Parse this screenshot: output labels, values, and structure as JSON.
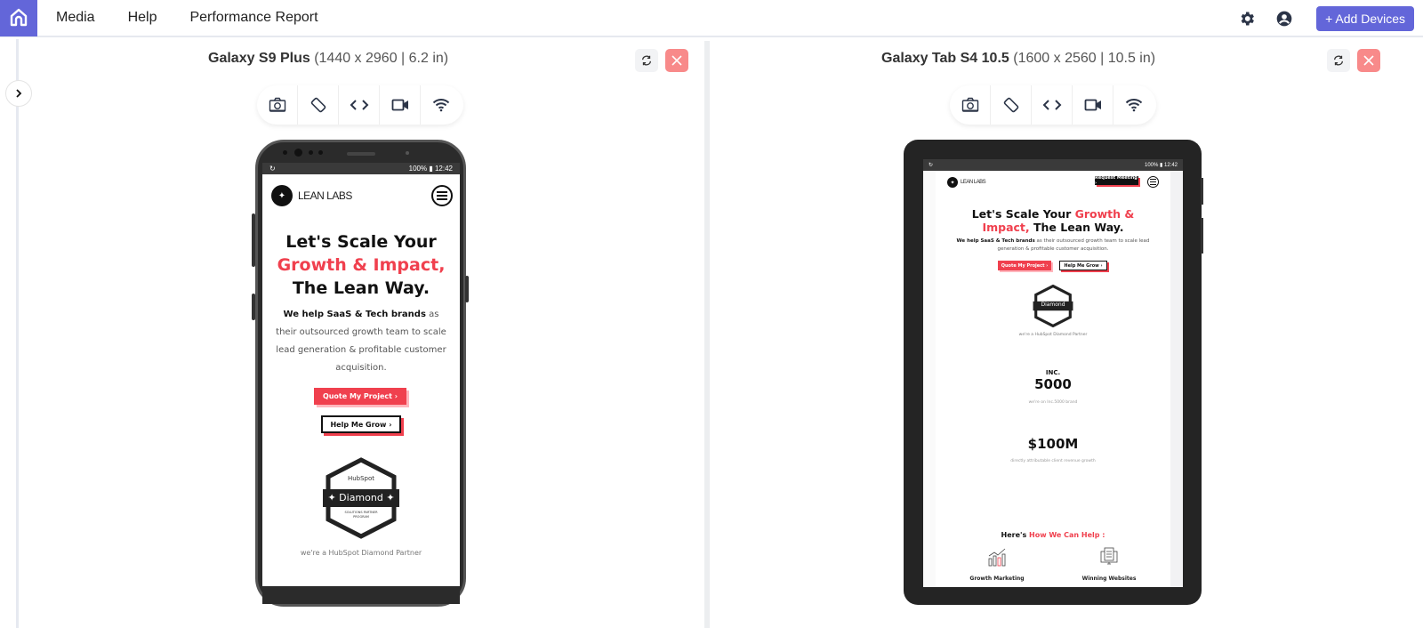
{
  "topbar": {
    "nav": [
      "Media",
      "Help",
      "Performance Report"
    ],
    "add_devices_label": "+ Add Devices",
    "colors": {
      "accent": "#6366d9",
      "close": "#f88a8a"
    }
  },
  "devices": [
    {
      "name": "Galaxy S9 Plus",
      "spec": "(1440 x 2960 | 6.2 in)",
      "status": {
        "time": "12:42",
        "battery": "100%"
      },
      "site": {
        "brand": "LEAN LABS",
        "headline_1": "Let's Scale Your",
        "headline_red": "Growth & Impact,",
        "headline_2": "The Lean Way.",
        "intro_bold": "We help SaaS & Tech brands",
        "intro_rest": " as their outsourced growth team to scale lead generation & profitable customer acquisition.",
        "btn_quote": "Quote My Project  ›",
        "btn_grow": "Help Me Grow  ›",
        "badge_top": "HubSpot",
        "badge_mid": "✦  Diamond  ✦",
        "badge_bottom": "SOLUTIONS PARTNER PROGRAM",
        "badge_caption": "we're a HubSpot Diamond Partner"
      }
    },
    {
      "name": "Galaxy Tab S4 10.5",
      "spec": "(1600 x 2560 | 10.5 in)",
      "status": {
        "time": "12:42",
        "battery": "100%"
      },
      "site": {
        "brand": "LEAN LABS",
        "request_btn": "Request Meeting  ›",
        "headline_a": "Let's Scale Your ",
        "headline_red_a": "Growth &",
        "headline_red_b": "Impact,",
        "headline_b": " The Lean Way.",
        "intro_bold": "We help SaaS & Tech brands",
        "intro_rest": " as their outsourced growth team to scale lead generation & profitable customer acquisition.",
        "btn_quote": "Quote My Project ›",
        "btn_grow": "Help Me Grow ›",
        "badge_mid": "Diamond",
        "badge_caption": "we're a HubSpot Diamond Partner",
        "stat1_label": "INC.",
        "stat1_value": "5000",
        "stat1_caption": "we're on Inc.5000 brand",
        "stat2_value": "$100M",
        "stat2_caption": "directly attributable client revenue growth",
        "help_heading": "Here's ",
        "help_heading_red": "How We Can Help :",
        "services": [
          "Growth Marketing",
          "Winning Websites"
        ]
      }
    }
  ]
}
